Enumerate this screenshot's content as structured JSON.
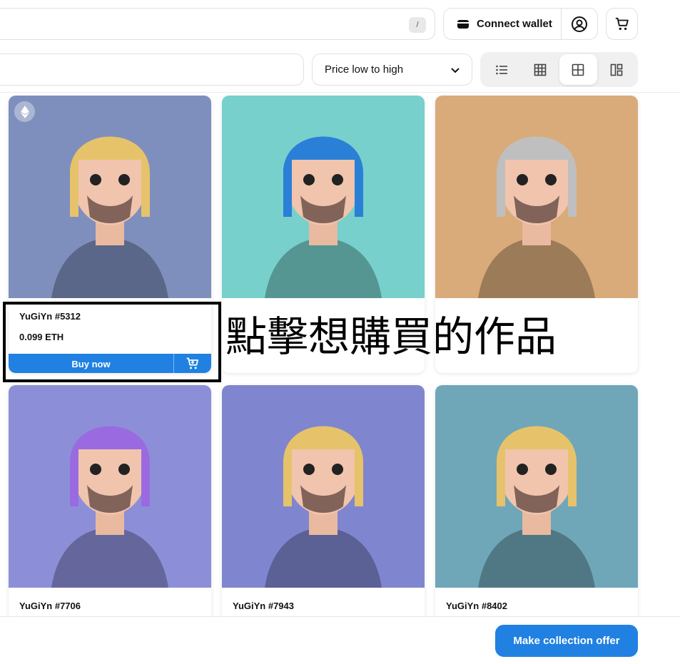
{
  "header": {
    "search_shortcut": "/",
    "connect_wallet_label": "Connect wallet",
    "wallet_icon": "wallet-icon",
    "profile_icon": "user-circle-icon",
    "cart_icon": "cart-icon"
  },
  "toolbar": {
    "sort_selected": "Price low to high",
    "view_modes": [
      "list-view-icon",
      "small-grid-view-icon",
      "large-grid-view-icon",
      "masonry-view-icon"
    ],
    "active_view": "large-grid-view-icon"
  },
  "cards": [
    {
      "name": "YuGiYn #5312",
      "price": "0.099 ETH",
      "bg": "#7f8fbd",
      "hair": "#e6c36a",
      "show_buy": true,
      "buy_label": "Buy now"
    },
    {
      "name": "",
      "price": "",
      "bg": "#77d0cc",
      "hair": "#2a7fd6",
      "show_buy": false
    },
    {
      "name": "",
      "price": "",
      "bg": "#d9ab7a",
      "hair": "#bfbfbf",
      "show_buy": false
    },
    {
      "name": "YuGiYn #7706",
      "price": "",
      "bg": "#8c8fd8",
      "hair": "#9a6be0",
      "show_buy": false
    },
    {
      "name": "YuGiYn #7943",
      "price": "",
      "bg": "#7f86cf",
      "hair": "#e6c36a",
      "show_buy": false
    },
    {
      "name": "YuGiYn #8402",
      "price": "",
      "bg": "#6fa7b8",
      "hair": "#e6c36a",
      "show_buy": false
    }
  ],
  "annotation": "點擊想購買的作品",
  "footer": {
    "offer_button": "Make collection offer"
  },
  "colors": {
    "accent": "#2081e2",
    "annotation_border": "#000000"
  }
}
